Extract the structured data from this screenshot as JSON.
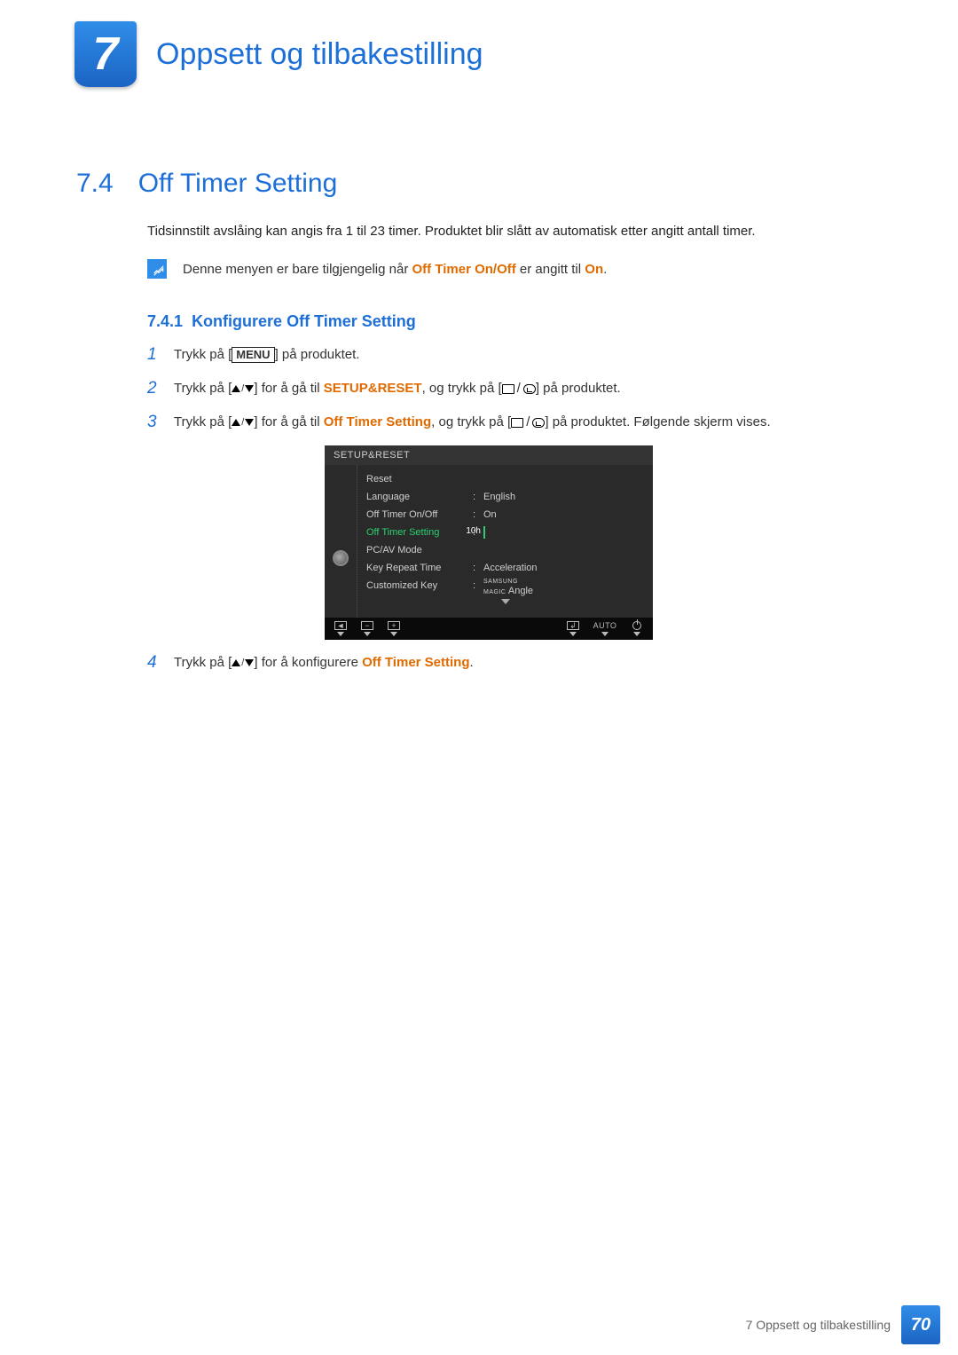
{
  "chapter": {
    "number": "7",
    "title": "Oppsett og tilbakestilling"
  },
  "section": {
    "number": "7.4",
    "title": "Off Timer Setting"
  },
  "intro": "Tidsinnstilt avslåing kan angis fra 1 til 23 timer. Produktet blir slått av automatisk etter angitt antall timer.",
  "note": {
    "pre": "Denne menyen er bare tilgjengelig når ",
    "bold": "Off Timer On/Off",
    "mid": " er angitt til ",
    "val": "On",
    "post": "."
  },
  "subsection": {
    "number": "7.4.1",
    "title": "Konfigurere Off Timer Setting"
  },
  "steps": {
    "s1": {
      "num": "1",
      "pre": "Trykk på [",
      "menu": "MENU",
      "post": "] på produktet."
    },
    "s2": {
      "num": "2",
      "pre": "Trykk på [",
      "mid1": "] for å gå til ",
      "target": "SETUP&RESET",
      "mid2": ", og trykk på [",
      "post": "] på produktet."
    },
    "s3": {
      "num": "3",
      "pre": "Trykk på [",
      "mid1": "] for å gå til ",
      "target": "Off Timer Setting",
      "mid2": ", og trykk på [",
      "post": "] på produktet. Følgende skjerm vises."
    },
    "s4": {
      "num": "4",
      "pre": "Trykk på [",
      "mid": "] for å konfigurere ",
      "target": "Off Timer Setting",
      "post": "."
    }
  },
  "osd": {
    "title": "SETUP&RESET",
    "rows": {
      "reset": "Reset",
      "language_l": "Language",
      "language_v": "English",
      "onoff_l": "Off Timer On/Off",
      "onoff_v": "On",
      "setting_l": "Off Timer Setting",
      "setting_v": "10h",
      "pcav_l": "PC/AV Mode",
      "keyrep_l": "Key Repeat Time",
      "keyrep_v": "Acceleration",
      "custkey_l": "Customized Key",
      "custkey_brand": "SAMSUNG",
      "custkey_magic": "MAGIC",
      "custkey_v": " Angle"
    },
    "footer": {
      "auto": "AUTO"
    }
  },
  "footer": {
    "text": "7 Oppsett og tilbakestilling",
    "page": "70"
  }
}
